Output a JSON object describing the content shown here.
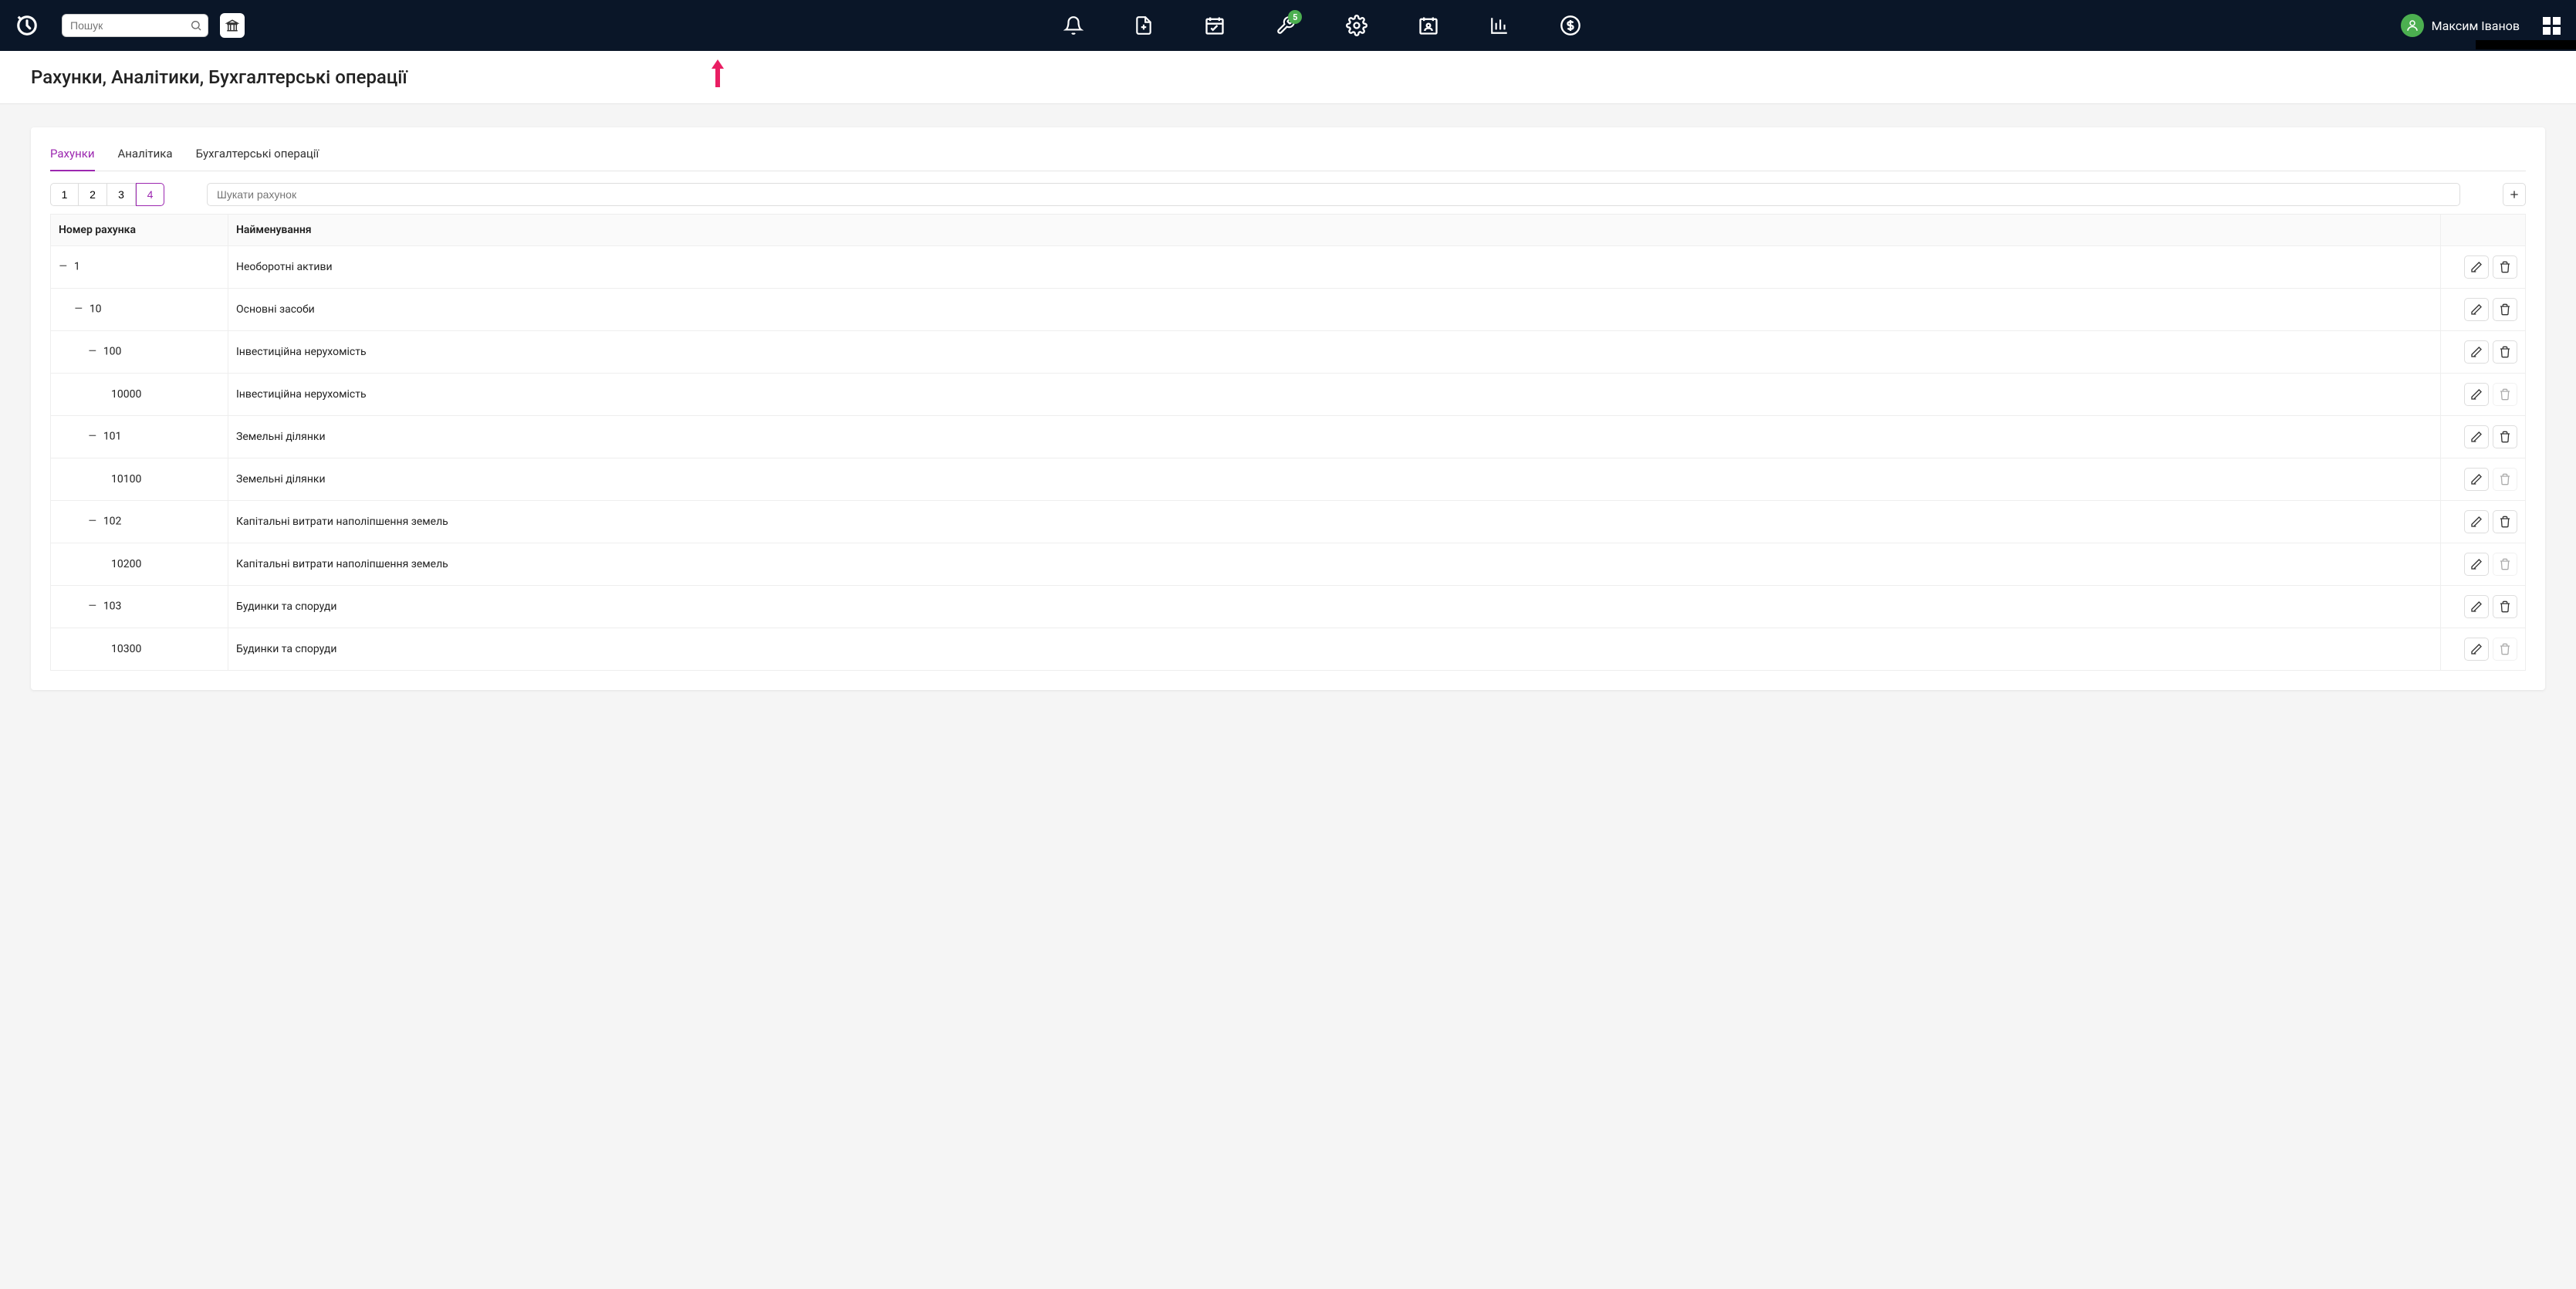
{
  "topbar": {
    "search_placeholder": "Пошук",
    "wrench_badge": "5",
    "user_name": "Максим Іванов"
  },
  "page": {
    "title": "Рахунки, Аналітики, Бухгалтерські операції"
  },
  "tabs": [
    {
      "label": "Рахунки",
      "active": true
    },
    {
      "label": "Аналітика",
      "active": false
    },
    {
      "label": "Бухгалтерські операції",
      "active": false
    }
  ],
  "page_buttons": [
    "1",
    "2",
    "3",
    "4"
  ],
  "active_page": "4",
  "filter_placeholder": "Шукати рахунок",
  "table": {
    "headers": {
      "number": "Номер рахунка",
      "name": "Найменування"
    },
    "rows": [
      {
        "indent": 0,
        "expandable": true,
        "number": "1",
        "name": "Необоротні активи",
        "delete_disabled": false
      },
      {
        "indent": 1,
        "expandable": true,
        "number": "10",
        "name": "Основні засоби",
        "delete_disabled": false
      },
      {
        "indent": 2,
        "expandable": true,
        "number": "100",
        "name": "Інвестиційна нерухомість",
        "delete_disabled": false
      },
      {
        "indent": 3,
        "expandable": false,
        "number": "10000",
        "name": "Інвестиційна нерухомість",
        "delete_disabled": true
      },
      {
        "indent": 2,
        "expandable": true,
        "number": "101",
        "name": "Земельні ділянки",
        "delete_disabled": false
      },
      {
        "indent": 3,
        "expandable": false,
        "number": "10100",
        "name": "Земельні ділянки",
        "delete_disabled": true
      },
      {
        "indent": 2,
        "expandable": true,
        "number": "102",
        "name": "Капітальні витрати наполіпшення земель",
        "delete_disabled": false
      },
      {
        "indent": 3,
        "expandable": false,
        "number": "10200",
        "name": "Капітальні витрати наполіпшення земель",
        "delete_disabled": true
      },
      {
        "indent": 2,
        "expandable": true,
        "number": "103",
        "name": "Будинки та споруди",
        "delete_disabled": false
      },
      {
        "indent": 3,
        "expandable": false,
        "number": "10300",
        "name": "Будинки та споруди",
        "delete_disabled": true
      }
    ]
  }
}
